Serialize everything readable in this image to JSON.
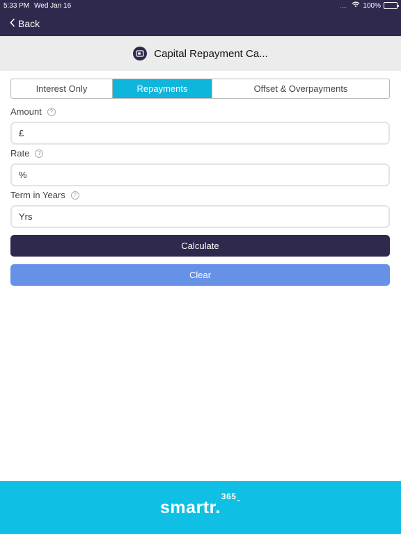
{
  "status": {
    "time": "5:33 PM",
    "date": "Wed Jan 16",
    "battery": "100%",
    "signal": "...."
  },
  "nav": {
    "back_label": "Back"
  },
  "header": {
    "title": "Capital Repayment Ca..."
  },
  "tabs": [
    {
      "label": "Interest Only",
      "active": false
    },
    {
      "label": "Repayments",
      "active": true
    },
    {
      "label": "Offset & Overpayments",
      "active": false
    }
  ],
  "form": {
    "amount": {
      "label": "Amount",
      "prefix": "£",
      "value": ""
    },
    "rate": {
      "label": "Rate",
      "prefix": "%",
      "value": ""
    },
    "term": {
      "label": "Term in Years",
      "placeholder": "Yrs",
      "value": ""
    },
    "help_symbol": "?"
  },
  "buttons": {
    "calculate": "Calculate",
    "clear": "Clear"
  },
  "footer": {
    "brand": "smartr.",
    "brand_sup": "365",
    "brand_tm": "™"
  },
  "colors": {
    "nav_bg": "#2f2a4d",
    "tab_active": "#0fb6dc",
    "clear_button": "#6591e6",
    "footer_bg": "#0fc0e4"
  }
}
